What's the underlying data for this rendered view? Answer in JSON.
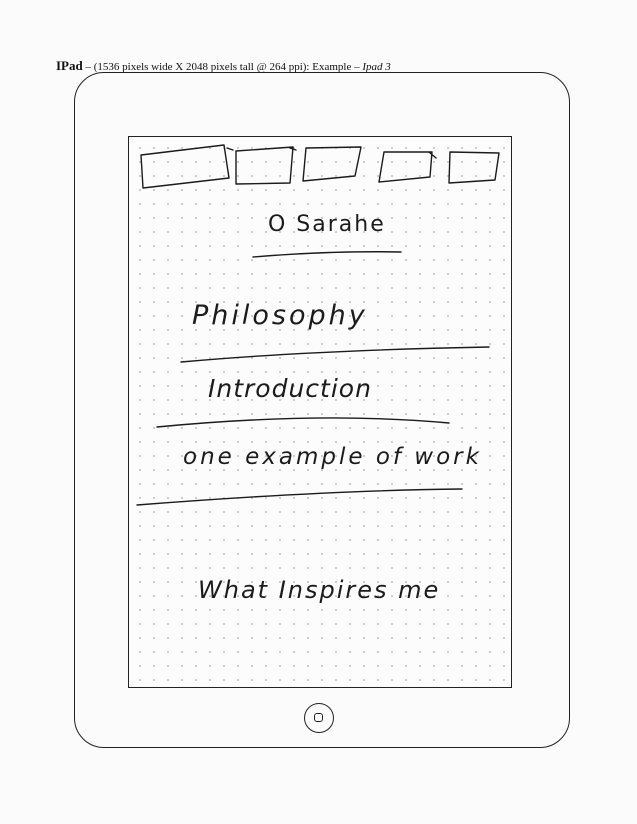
{
  "header": {
    "device": "IPad",
    "dash": "–",
    "spec": "(1536 pixels wide X 2048 pixels tall @ 264 ppi): Example",
    "dash2": "–",
    "model": "Ipad 3"
  },
  "sketch": {
    "title": "O Sarahe",
    "items": [
      {
        "label": "Philosophy"
      },
      {
        "label": "Introduction"
      },
      {
        "label": "one example of work"
      },
      {
        "label": "What Inspires me"
      }
    ]
  }
}
